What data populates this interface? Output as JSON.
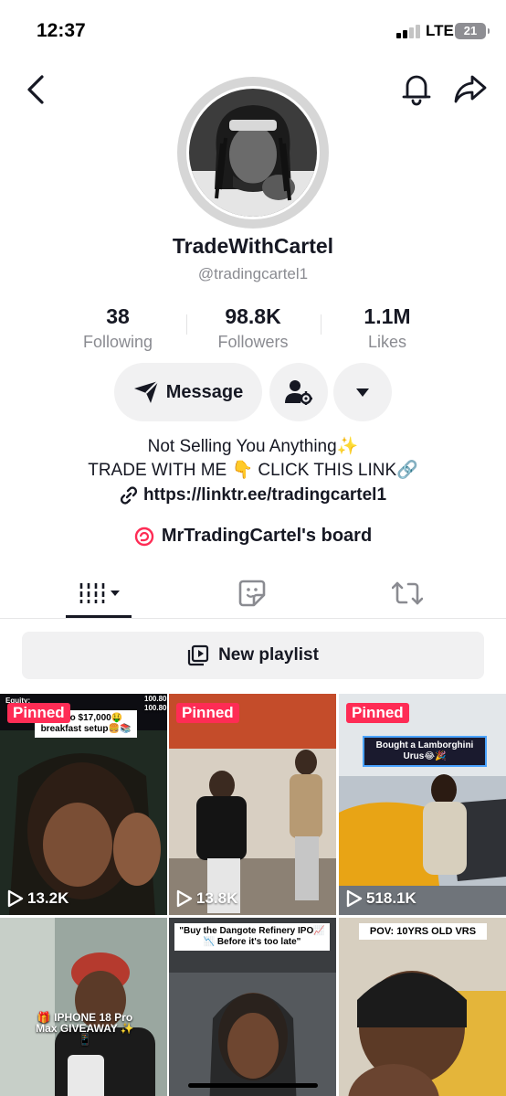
{
  "status_bar": {
    "time": "12:37",
    "network": "LTE",
    "battery": "21"
  },
  "profile": {
    "display_name": "TradeWithCartel",
    "username": "@tradingcartel1",
    "stats": [
      {
        "value": "38",
        "label": "Following"
      },
      {
        "value": "98.8K",
        "label": "Followers"
      },
      {
        "value": "1.1M",
        "label": "Likes"
      }
    ],
    "bio": {
      "line1": "Not Selling You Anything✨",
      "line2": "TRADE WITH ME 👇 CLICK THIS LINK🔗",
      "link": "https://linktr.ee/tradingcartel1"
    },
    "board": "MrTradingCartel's board"
  },
  "actions": {
    "message_label": "Message"
  },
  "playlist": {
    "label": "New playlist"
  },
  "icons": {
    "back": "chevron-left-icon",
    "bell": "bell-icon",
    "share": "share-icon",
    "message": "paper-plane-icon",
    "add_friend": "user-gear-icon",
    "more": "caret-down-icon",
    "link": "link-icon",
    "board": "board-icon",
    "videos_tab": "grid-icon",
    "favorites_tab": "sticker-icon",
    "reposts_tab": "repost-icon",
    "playlist": "playlist-icon",
    "play": "play-icon"
  },
  "colors": {
    "accent": "#fe2c55",
    "text": "#161823",
    "muted": "#8a8b91",
    "button_bg": "#f1f1f2"
  },
  "videos": [
    {
      "pinned": "Pinned",
      "views": "13.2K",
      "caption": "100 to $17,000🤑 breakfast setup🍔📚",
      "overlay_top": "Equity:",
      "overlay_num1": "100.80",
      "overlay_num2": "100.80"
    },
    {
      "pinned": "Pinned",
      "views": "13.8K",
      "caption": ""
    },
    {
      "pinned": "Pinned",
      "views": "518.1K",
      "caption": "Bought a Lamborghini Urus😂🎉"
    },
    {
      "pinned": "",
      "views": "",
      "caption": "🎁 IPHONE 18 Pro Max GIVEAWAY ✨📱"
    },
    {
      "pinned": "",
      "views": "",
      "caption": "\"Buy the Dangote Refinery IPO📈📉 Before it's too late\""
    },
    {
      "pinned": "",
      "views": "",
      "caption": "POV: 10YRS OLD VRS"
    }
  ]
}
